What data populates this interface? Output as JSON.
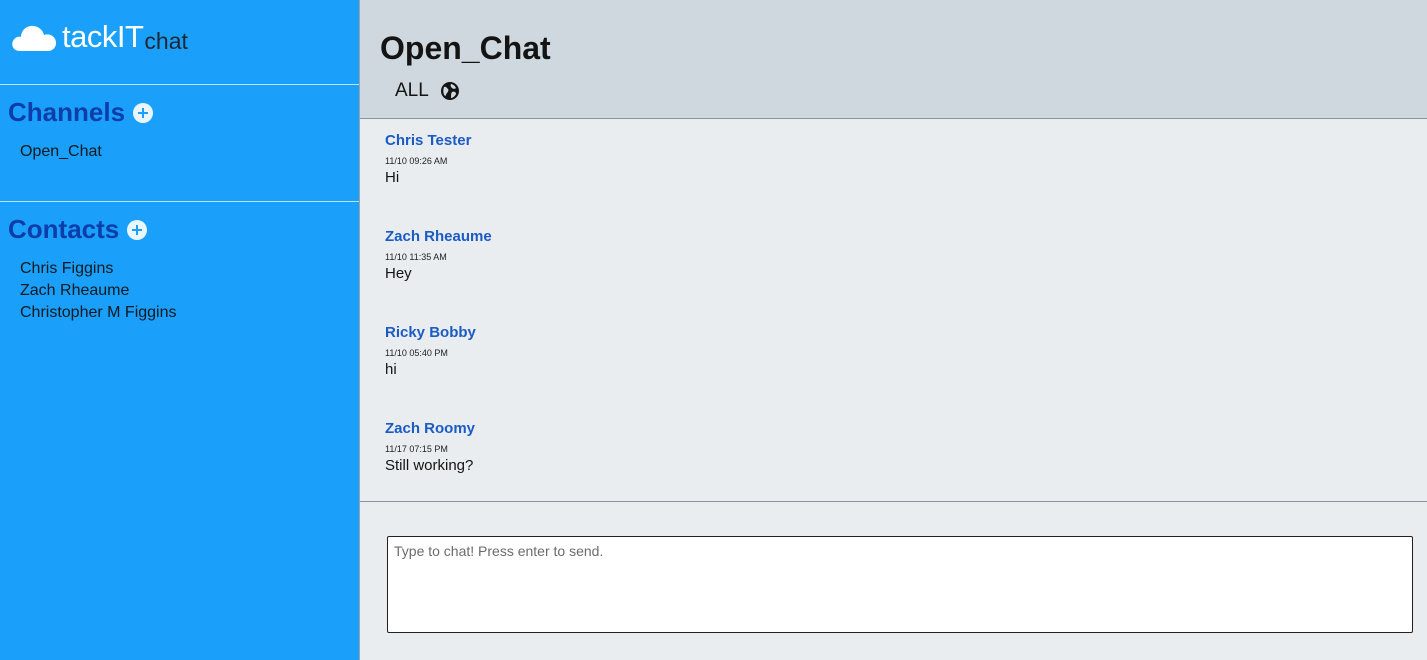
{
  "app": {
    "logo_main": "tackIT",
    "logo_sub": "chat",
    "logo_icon": "cloud-icon"
  },
  "sidebar": {
    "channels_title": "Channels",
    "channels": [
      {
        "label": "Open_Chat"
      }
    ],
    "contacts_title": "Contacts",
    "contacts": [
      {
        "label": "Chris Figgins"
      },
      {
        "label": "Zach Rheaume"
      },
      {
        "label": "Christopher M Figgins"
      }
    ]
  },
  "header": {
    "title": "Open_Chat",
    "scope_label": "ALL",
    "scope_icon": "globe-icon"
  },
  "messages": [
    {
      "author": "Chris Tester",
      "time": "11/10 09:26 AM",
      "text": "Hi"
    },
    {
      "author": "Zach Rheaume",
      "time": "11/10 11:35 AM",
      "text": "Hey"
    },
    {
      "author": "Ricky Bobby",
      "time": "11/10 05:40 PM",
      "text": "hi"
    },
    {
      "author": "Zach Roomy",
      "time": "11/17 07:15 PM",
      "text": "Still working?"
    }
  ],
  "composer": {
    "placeholder": "Type to chat! Press enter to send.",
    "value": ""
  },
  "colors": {
    "sidebar_bg": "#1aa0fa",
    "section_title": "#0c3da8",
    "author_link": "#1b5bc4",
    "header_bg": "#cfd8de",
    "content_bg": "#e9edf0"
  }
}
